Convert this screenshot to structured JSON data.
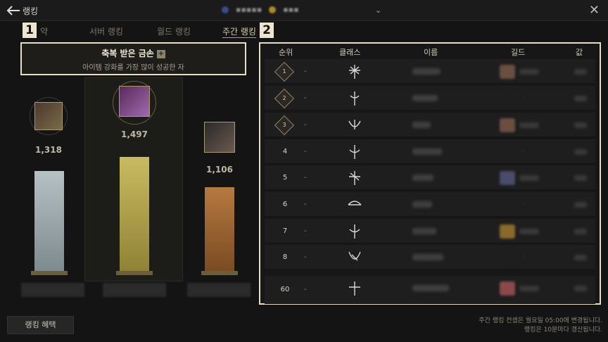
{
  "window": {
    "title": "랭킹"
  },
  "top_center": {
    "text_a": "▪▪▪▪▪",
    "text_b": "▪▪▪"
  },
  "tabs": [
    {
      "label": "약"
    },
    {
      "label": "서버 랭킹"
    },
    {
      "label": "월드 랭킹"
    },
    {
      "label": "주간 랭킹"
    }
  ],
  "badges": [
    "1",
    "2"
  ],
  "featured": {
    "title": "축복 받은 금손",
    "plus": "+",
    "subtitle": "아이템 강화를 가장 많이 성공한 자"
  },
  "podium": [
    {
      "place": 2,
      "value": "1,318",
      "value_num": 1318,
      "bar_color": "#9aa7ab"
    },
    {
      "place": 1,
      "value": "1,497",
      "value_num": 1497,
      "bar_color": "#b9a94f"
    },
    {
      "place": 3,
      "value": "1,106",
      "value_num": 1106,
      "bar_color": "#a06a35"
    }
  ],
  "table": {
    "headers": {
      "rank": "순위",
      "class": "클래스",
      "name": "이름",
      "guild": "길드",
      "value": "값"
    },
    "rows": [
      {
        "rank": "1",
        "change": "-",
        "has_guild": true,
        "guild_color": "#6a4e40"
      },
      {
        "rank": "2",
        "change": "-",
        "has_guild": false,
        "guild_placeholder": "-"
      },
      {
        "rank": "3",
        "change": "-",
        "has_guild": true,
        "guild_color": "#6a4e40"
      },
      {
        "rank": "4",
        "change": "-",
        "has_guild": false,
        "guild_placeholder": "-"
      },
      {
        "rank": "5",
        "change": "-",
        "has_guild": true,
        "guild_color": "#4a4a6a"
      },
      {
        "rank": "6",
        "change": "-",
        "has_guild": false,
        "guild_placeholder": "-"
      },
      {
        "rank": "7",
        "change": "-",
        "has_guild": true,
        "guild_color": "#8a6a2a"
      },
      {
        "rank": "8",
        "change": "-",
        "has_guild": false,
        "guild_placeholder": "-"
      },
      {
        "rank": "60",
        "change": "-",
        "has_guild": true,
        "guild_color": "#8a4a4a"
      }
    ]
  },
  "benefit_button": {
    "label": "랭킹 혜택"
  },
  "footer": {
    "line1": "주간 랭킹 컨셉은 월요일 05:00에 변경됩니다.",
    "line2": "랭킹은 10분마다 갱신됩니다."
  },
  "colors": {
    "highlight_border": "#e6dfc6",
    "gold": "#b9a94f"
  }
}
